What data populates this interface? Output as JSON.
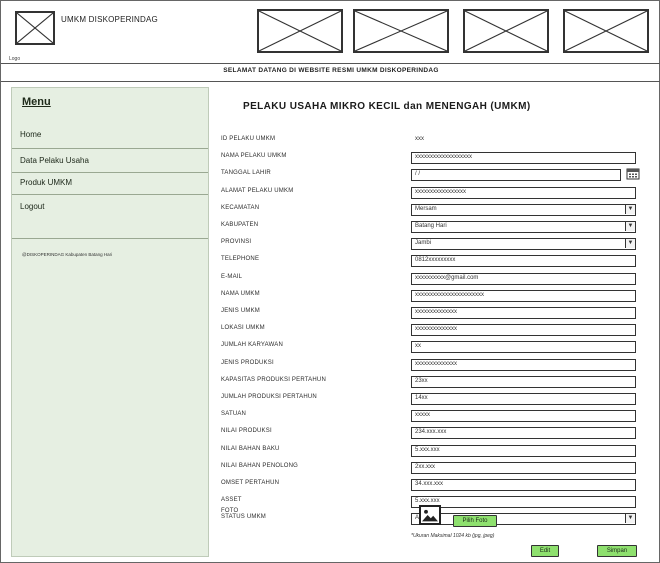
{
  "header": {
    "app_title": "UMKM DISKOPERINDAG",
    "logo_caption": "Logo",
    "welcome": "SELAMAT DATANG DI WEBSITE RESMI UMKM DISKOPERINDAG"
  },
  "sidebar": {
    "menu_title": "Menu",
    "items": [
      {
        "label": "Home"
      },
      {
        "label": "Data Pelaku Usaha"
      },
      {
        "label": "Produk UMKM"
      },
      {
        "label": "Logout"
      }
    ],
    "footer": "@DISKOPERINDAG Kabupaten Batang Hari"
  },
  "form": {
    "title": "PELAKU USAHA MIKRO KECIL dan MENENGAH (UMKM)",
    "fields": [
      {
        "label": "ID PELAKU UMKM",
        "value": "xxx",
        "type": "plain"
      },
      {
        "label": "NAMA PELAKU UMKM",
        "value": "xxxxxxxxxxxxxxxxxxx",
        "type": "text"
      },
      {
        "label": "TANGGAL LAHIR",
        "value": "/ /",
        "type": "date"
      },
      {
        "label": "ALAMAT PELAKU UMKM",
        "value": "xxxxxxxxxxxxxxxxx",
        "type": "text"
      },
      {
        "label": "KECAMATAN",
        "value": "Mersam",
        "type": "select"
      },
      {
        "label": "KABUPATEN",
        "value": "Batang Hari",
        "type": "select"
      },
      {
        "label": "PROVINSI",
        "value": "Jambi",
        "type": "select"
      },
      {
        "label": "TELEPHONE",
        "value": "0812xxxxxxxxx",
        "type": "text"
      },
      {
        "label": "E-MAIL",
        "value": "xxxxxxxxxx@gmail.com",
        "type": "text"
      },
      {
        "label": "NAMA UMKM",
        "value": "xxxxxxxxxxxxxxxxxxxxxxx",
        "type": "text"
      },
      {
        "label": "JENIS UMKM",
        "value": "xxxxxxxxxxxxxx",
        "type": "text"
      },
      {
        "label": "LOKASI UMKM",
        "value": "xxxxxxxxxxxxxx",
        "type": "text"
      },
      {
        "label": "JUMLAH KARYAWAN",
        "value": "xx",
        "type": "text"
      },
      {
        "label": "JENIS PRODUKSI",
        "value": "xxxxxxxxxxxxxx",
        "type": "text"
      },
      {
        "label": "KAPASITAS PRODUKSI PERTAHUN",
        "value": "23xx",
        "type": "text"
      },
      {
        "label": "JUMLAH PRODUKSI PERTAHUN",
        "value": "14xx",
        "type": "text"
      },
      {
        "label": "SATUAN",
        "value": "xxxxx",
        "type": "text"
      },
      {
        "label": "NILAI PRODUKSI",
        "value": "234.xxx.xxx",
        "type": "text"
      },
      {
        "label": "NILAI BAHAN BAKU",
        "value": "5.xxx.xxx",
        "type": "text"
      },
      {
        "label": "NILAI BAHAN PENOLONG",
        "value": "2xx.xxx",
        "type": "text"
      },
      {
        "label": "OMSET PERTAHUN",
        "value": "34.xxx.xxx",
        "type": "text"
      },
      {
        "label": "ASSET",
        "value": "5.xxx.xxx",
        "type": "text"
      },
      {
        "label": "STATUS UMKM",
        "value": "Aktif",
        "type": "select"
      }
    ],
    "photo_label": "FOTO",
    "choose_photo": "Pilih Foto",
    "photo_note": "*Ukuran Maksimal 1024 kb (jpg, jpeg)",
    "edit": "Edit",
    "save": "Simpan"
  },
  "icons": {
    "logo": "logo-placeholder-icon",
    "banner": "image-placeholder-icon",
    "calendar": "calendar-icon",
    "photo": "image-icon",
    "dropdown": "chevron-down-icon"
  },
  "colors": {
    "sidebar_bg": "#e6efe2",
    "button_bg": "#8ee06e"
  }
}
